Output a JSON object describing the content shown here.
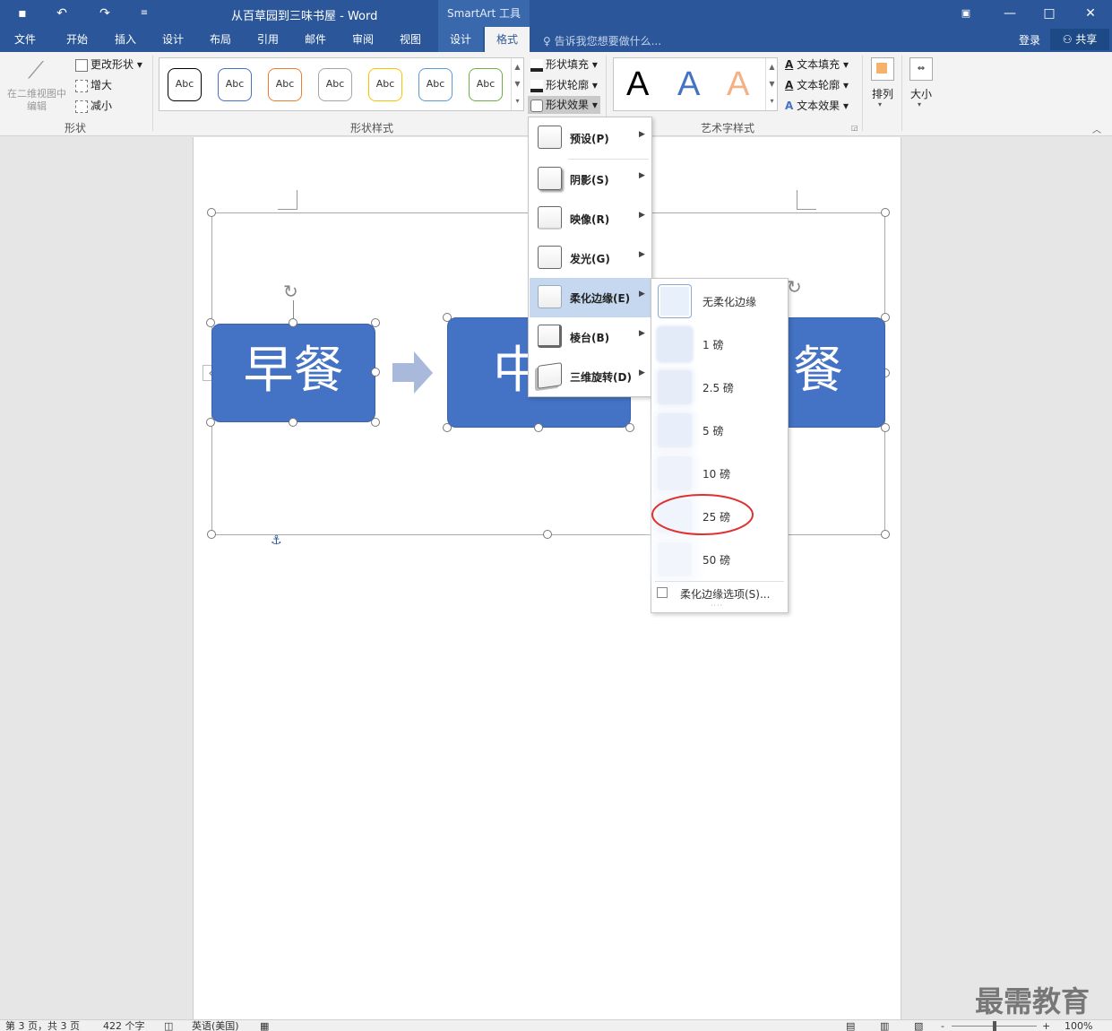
{
  "titlebar": {
    "doc_title": "从百草园到三味书屋 - Word",
    "context_tool": "SmartArt 工具",
    "qa_save": "💾",
    "qa_undo": "↶",
    "qa_redo": "↷",
    "qa_more": "≡"
  },
  "tabs": [
    "文件",
    "开始",
    "插入",
    "设计",
    "布局",
    "引用",
    "邮件",
    "审阅",
    "视图",
    "设计",
    "格式"
  ],
  "tell_me": "告诉我您想要做什么...",
  "login": "登录",
  "share": "共享",
  "ribbon": {
    "shapes_group": {
      "edit_2d": "在二维视图中编辑",
      "change_shape": "更改形状",
      "larger": "增大",
      "smaller": "减小",
      "label": "形状"
    },
    "shape_styles": {
      "swatches": [
        {
          "text": "Abc",
          "color": "#000000"
        },
        {
          "text": "Abc",
          "color": "#4472c4"
        },
        {
          "text": "Abc",
          "color": "#ed7d31"
        },
        {
          "text": "Abc",
          "color": "#a5a5a5"
        },
        {
          "text": "Abc",
          "color": "#ffc000"
        },
        {
          "text": "Abc",
          "color": "#5b9bd5"
        },
        {
          "text": "Abc",
          "color": "#70ad47"
        }
      ],
      "fill": "形状填充",
      "outline": "形状轮廓",
      "effects": "形状效果",
      "label": "形状样式"
    },
    "wordart": {
      "samples": [
        {
          "text": "A",
          "color": "#000000"
        },
        {
          "text": "A",
          "color": "#4472c4"
        },
        {
          "text": "A",
          "color": "#f4b183"
        }
      ],
      "text_fill": "文本填充",
      "text_outline": "文本轮廓",
      "text_effects": "文本效果",
      "label": "艺术字样式"
    },
    "arrange": "排列",
    "size": "大小"
  },
  "diagram": {
    "boxes": [
      "早餐",
      "中",
      "餐"
    ]
  },
  "effects_menu": {
    "items": [
      "预设(P)",
      "阴影(S)",
      "映像(R)",
      "发光(G)",
      "柔化边缘(E)",
      "棱台(B)",
      "三维旋转(D)"
    ],
    "highlighted": "柔化边缘(E)"
  },
  "soft_edges_menu": {
    "items": [
      "无柔化边缘",
      "1 磅",
      "2.5 磅",
      "5 磅",
      "10 磅",
      "25 磅",
      "50 磅"
    ],
    "options": "柔化边缘选项(S)...",
    "circled": "25 磅",
    "circle_color": "#e03030"
  },
  "status": {
    "page": "第 3 页，共 3 页",
    "words": "422 个字",
    "language": "英语(美国)",
    "zoom": "100%"
  },
  "watermark": "最需教育"
}
